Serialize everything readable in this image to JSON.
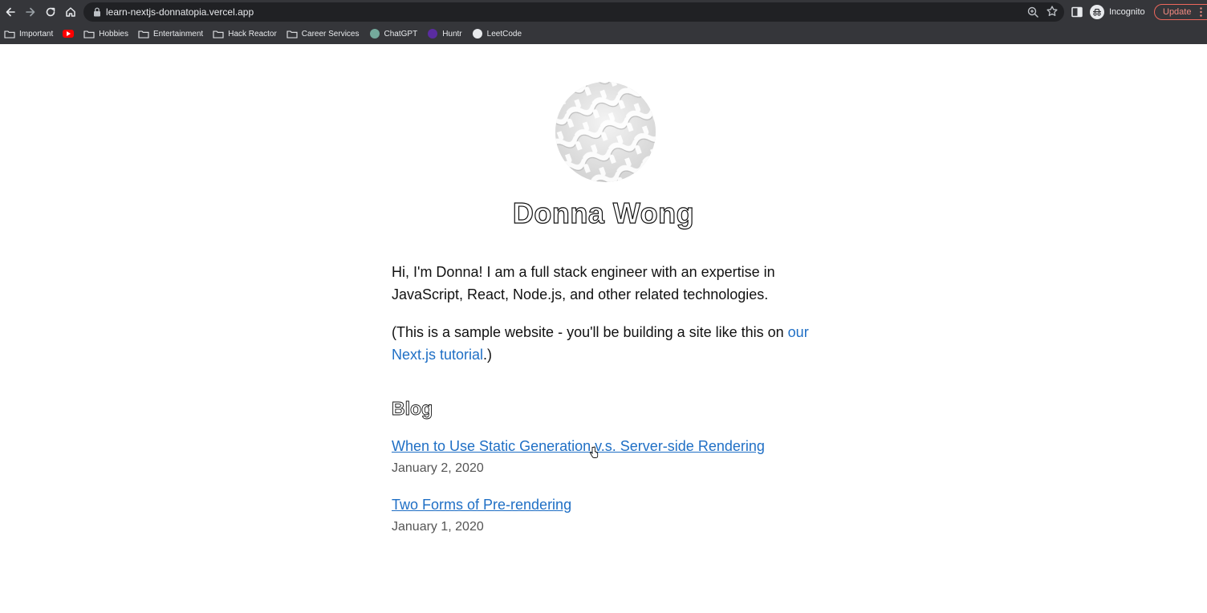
{
  "browser": {
    "url": "learn-nextjs-donnatopia.vercel.app",
    "profile_label": "Incognito",
    "update_label": "Update",
    "bookmarks": [
      {
        "label": "Important",
        "icon": "folder-icon"
      },
      {
        "label": "",
        "icon": "youtube-icon"
      },
      {
        "label": "Hobbies",
        "icon": "folder-icon"
      },
      {
        "label": "Entertainment",
        "icon": "folder-icon"
      },
      {
        "label": "Hack Reactor",
        "icon": "folder-icon"
      },
      {
        "label": "Career Services",
        "icon": "folder-icon"
      },
      {
        "label": "ChatGPT",
        "icon": "chatgpt-icon"
      },
      {
        "label": "Huntr",
        "icon": "huntr-icon"
      },
      {
        "label": "LeetCode",
        "icon": "github-icon"
      }
    ]
  },
  "profile": {
    "name": "Donna Wong",
    "intro": "Hi, I'm Donna! I am a full stack engineer with an expertise in JavaScript, React, Node.js, and other related technologies.",
    "note_prefix": "(This is a sample website - you'll be building a site like this on ",
    "note_link": "our Next.js tutorial",
    "note_suffix": ".)"
  },
  "blog": {
    "heading": "Blog",
    "posts": [
      {
        "title": "When to Use Static Generation v.s. Server-side Rendering",
        "date": "January 2, 2020"
      },
      {
        "title": "Two Forms of Pre-rendering",
        "date": "January 1, 2020"
      }
    ]
  },
  "colors": {
    "chrome_bg": "#35363a",
    "omnibox_bg": "#202124",
    "link": "#1f6fc5"
  }
}
